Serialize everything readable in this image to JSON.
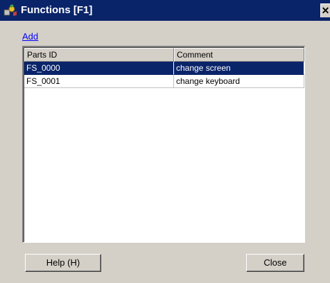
{
  "window": {
    "title": "Functions [F1]",
    "close_glyph": "✕",
    "icon": "functions-app-icon"
  },
  "toolbar": {
    "add_label": "Add"
  },
  "list": {
    "columns": [
      "Parts ID",
      "Comment"
    ],
    "rows": [
      {
        "parts_id": "FS_0000",
        "comment": "change screen",
        "selected": true
      },
      {
        "parts_id": "FS_0001",
        "comment": "change keyboard",
        "selected": false
      }
    ]
  },
  "buttons": {
    "help_label": "Help (H)",
    "close_label": "Close"
  },
  "colors": {
    "titlebar": "#0a246a",
    "selection": "#0a246a",
    "face": "#d4d0c8",
    "link": "#0000ff"
  }
}
